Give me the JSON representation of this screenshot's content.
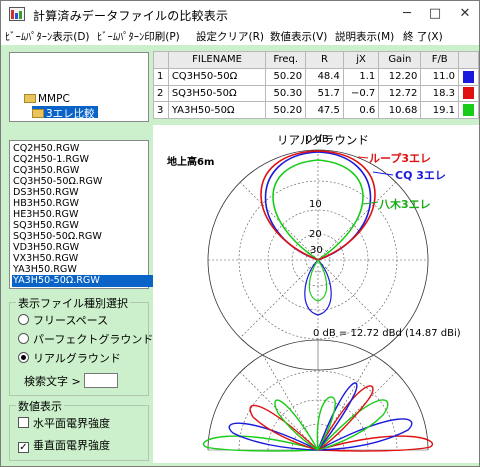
{
  "window": {
    "title": "計算済みデータファイルの比較表示",
    "minimize_label": "─",
    "maximize_label": "□",
    "close_label": "✕"
  },
  "menu": [
    "ﾋﾞｰﾑﾊﾟﾀｰﾝ表示(D)",
    "ﾋﾞｰﾑﾊﾟﾀｰﾝ印刷(P)",
    "設定クリア(R)",
    "数値表示(V)",
    "説明表示(M)",
    "終 了(X)"
  ],
  "folders": [
    "MMPC",
    "3エレ比較"
  ],
  "files": [
    "CQ2H50.RGW",
    "CQ2H50-1.RGW",
    "CQ3H50.RGW",
    "CQ3H50-50Ω.RGW",
    "DS3H50.RGW",
    "HB3H50.RGW",
    "HE3H50.RGW",
    "SQ3H50.RGW",
    "SQ3H50-50Ω.RGW",
    "VD3H50.RGW",
    "VX3H50.RGW",
    "YA3H50.RGW",
    "YA3H50-50Ω.RGW"
  ],
  "selected_file_index": 12,
  "display_type": {
    "legend": "表示ファイル種別選択",
    "options": [
      "フリースペース",
      "パーフェクトグラウンド",
      "リアルグラウンド"
    ],
    "selected_index": 2
  },
  "search": {
    "label": "検索文字 >",
    "value": ""
  },
  "numeric_display": {
    "legend": "数値表示",
    "options": [
      {
        "label": "水平面電界強度",
        "checked": false
      },
      {
        "label": "垂直面電界強度",
        "checked": true
      }
    ]
  },
  "table": {
    "headers": [
      "",
      "FILENAME",
      "Freq.",
      "R",
      "jX",
      "Gain",
      "F/B",
      ""
    ],
    "rows": [
      {
        "no": "1",
        "filename": "CQ3H50-50Ω",
        "freq": "50.20",
        "r": "48.4",
        "jx": "1.1",
        "gain": "12.20",
        "fb": "11.0",
        "color": "#1a1adc"
      },
      {
        "no": "2",
        "filename": "SQ3H50-50Ω",
        "freq": "50.30",
        "r": "51.7",
        "jx": "−0.7",
        "gain": "12.72",
        "fb": "18.3",
        "color": "#e01010"
      },
      {
        "no": "3",
        "filename": "YA3H50-50Ω",
        "freq": "50.20",
        "r": "47.5",
        "jx": "0.6",
        "gain": "10.68",
        "fb": "19.1",
        "color": "#18cc18"
      }
    ]
  },
  "chart": {
    "title": "リアルグラウンド",
    "height_label": "地上高6m",
    "ring_labels": [
      "0 dB",
      "10",
      "20",
      "30"
    ],
    "series_labels": [
      {
        "name": "ループ3エレ",
        "color": "#e01010"
      },
      {
        "name": "CQ 3エレ",
        "color": "#1a1adc"
      },
      {
        "name": "八木3エレ",
        "color": "#18aa18"
      }
    ],
    "reference_label": "0 dB = 12.72 dBd (14.87 dBi)"
  }
}
